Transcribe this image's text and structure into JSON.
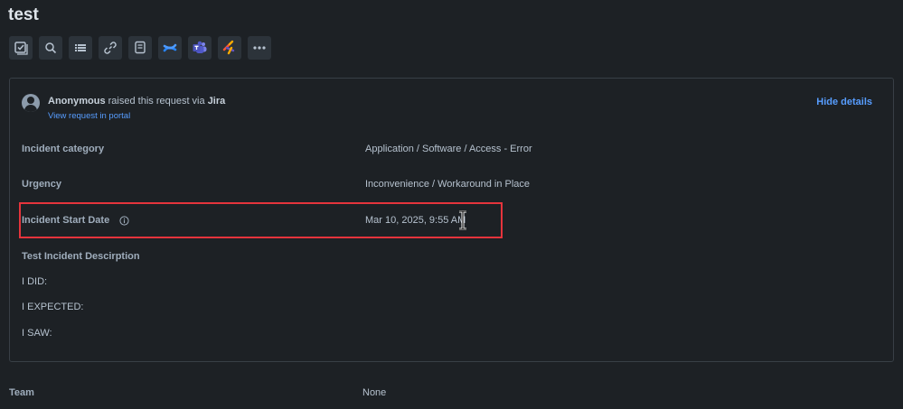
{
  "issue": {
    "title": "test"
  },
  "toolbar": {
    "buttons": [
      {
        "icon": "checklist-icon"
      },
      {
        "icon": "search-icon"
      },
      {
        "icon": "list-icon"
      },
      {
        "icon": "link-icon"
      },
      {
        "icon": "note-icon"
      },
      {
        "icon": "confluence-icon"
      },
      {
        "icon": "teams-icon"
      },
      {
        "icon": "slack-icon"
      },
      {
        "icon": "more-icon"
      }
    ]
  },
  "request": {
    "requester": "Anonymous",
    "raised_text": "raised this request via",
    "channel": "Jira",
    "portal_link": "View request in portal",
    "hide_details": "Hide details"
  },
  "fields": [
    {
      "label": "Incident category",
      "value": "Application / Software / Access - Error"
    },
    {
      "label": "Urgency",
      "value": "Inconvenience / Workaround in Place"
    },
    {
      "label": "Incident Start Date",
      "value": "Mar 10, 2025, 9:55 AM"
    }
  ],
  "description": {
    "title": "Test Incident Descirption",
    "lines": [
      "I DID:",
      "I EXPECTED:",
      "I SAW:"
    ]
  },
  "team": {
    "label": "Team",
    "value": "None"
  },
  "colors": {
    "background": "#1d2125",
    "link": "#579dff",
    "highlight": "#e5343c"
  }
}
